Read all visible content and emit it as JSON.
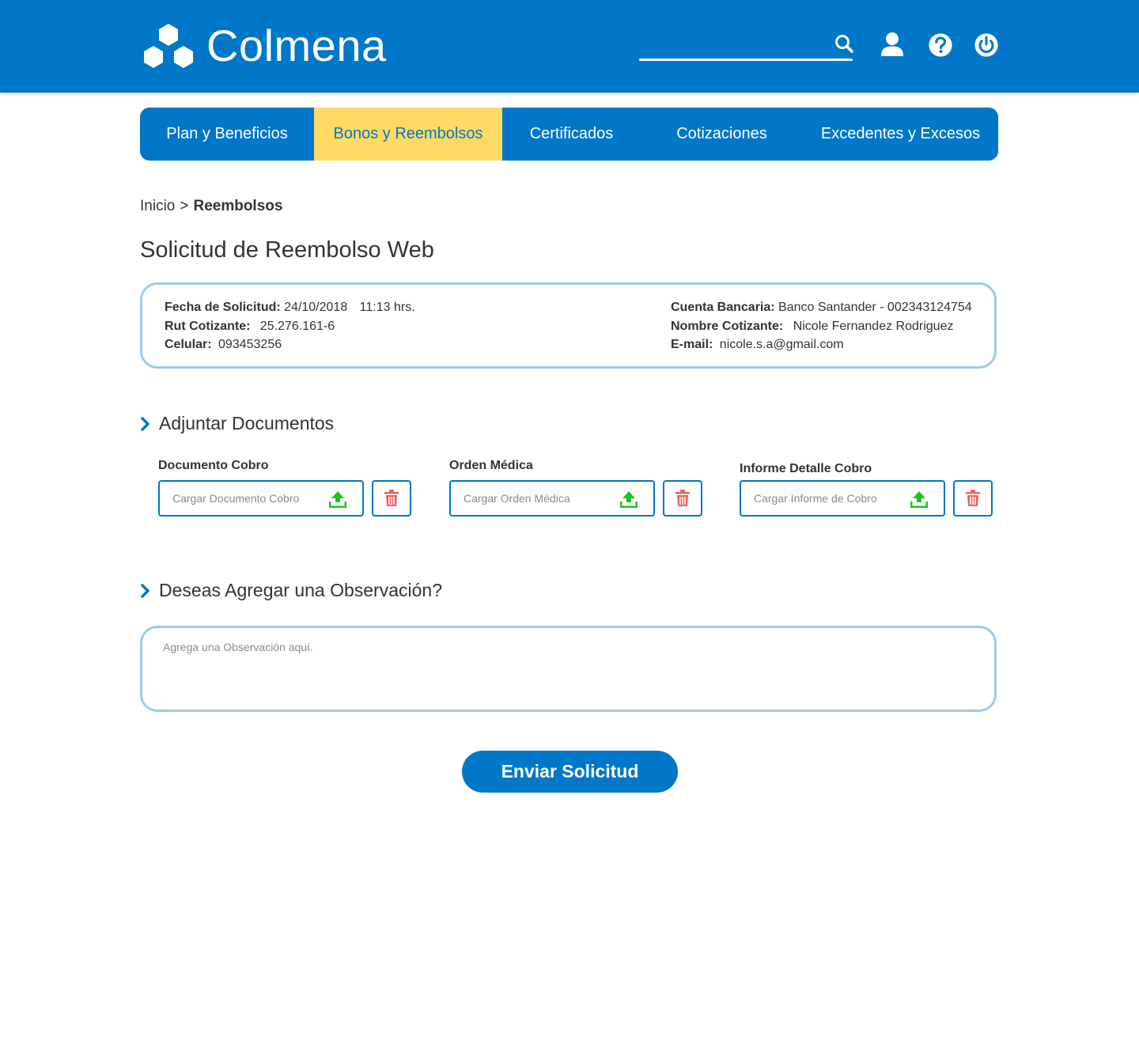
{
  "header": {
    "brand": "Colmena",
    "search_placeholder": "",
    "icons": [
      "search-icon",
      "user-icon",
      "help-icon",
      "power-icon"
    ]
  },
  "nav": {
    "items": [
      {
        "label": "Plan y Beneficios",
        "active": false
      },
      {
        "label": "Bonos y Reembolsos",
        "active": true
      },
      {
        "label": "Certificados",
        "active": false
      },
      {
        "label": "Cotizaciones",
        "active": false
      },
      {
        "label": "Excedentes y Excesos",
        "active": false
      }
    ]
  },
  "breadcrumb": {
    "home": "Inicio",
    "separator": ">",
    "current": "Reembolsos"
  },
  "page_title": "Solicitud de Reembolso Web",
  "info": {
    "fecha_label": "Fecha de Solicitud:",
    "fecha_value": "24/10/2018",
    "hora_value": "11:13 hrs.",
    "rut_label": "Rut Cotizante:",
    "rut_value": "25.276.161-6",
    "celular_label": "Celular:",
    "celular_value": "093453256",
    "cuenta_label": "Cuenta Bancaria:",
    "cuenta_value": "Banco Santander - 002343124754",
    "nombre_label": "Nombre Cotizante:",
    "nombre_value": "Nicole Fernandez Rodriguez",
    "email_label": "E-mail:",
    "email_value": "nicole.s.a@gmail.com"
  },
  "documents": {
    "title": "Adjuntar Documentos",
    "fields": [
      {
        "label": "Documento Cobro",
        "placeholder": "Cargar Documento Cobro"
      },
      {
        "label": "Orden Médica",
        "placeholder": "Cargar Orden Médica"
      },
      {
        "label": "Informe Detalle Cobro",
        "placeholder": "Cargar Informe de Cobro"
      }
    ]
  },
  "observation": {
    "title": "Deseas Agregar una Observación?",
    "placeholder": "Agrega una Observación aquí."
  },
  "submit_label": "Enviar Solicitud",
  "colors": {
    "primary": "#0077c8",
    "active_tab": "#fedb63",
    "card_border": "#9ccbe8",
    "upload_green": "#1ec41e",
    "trash_red": "#f06262"
  }
}
